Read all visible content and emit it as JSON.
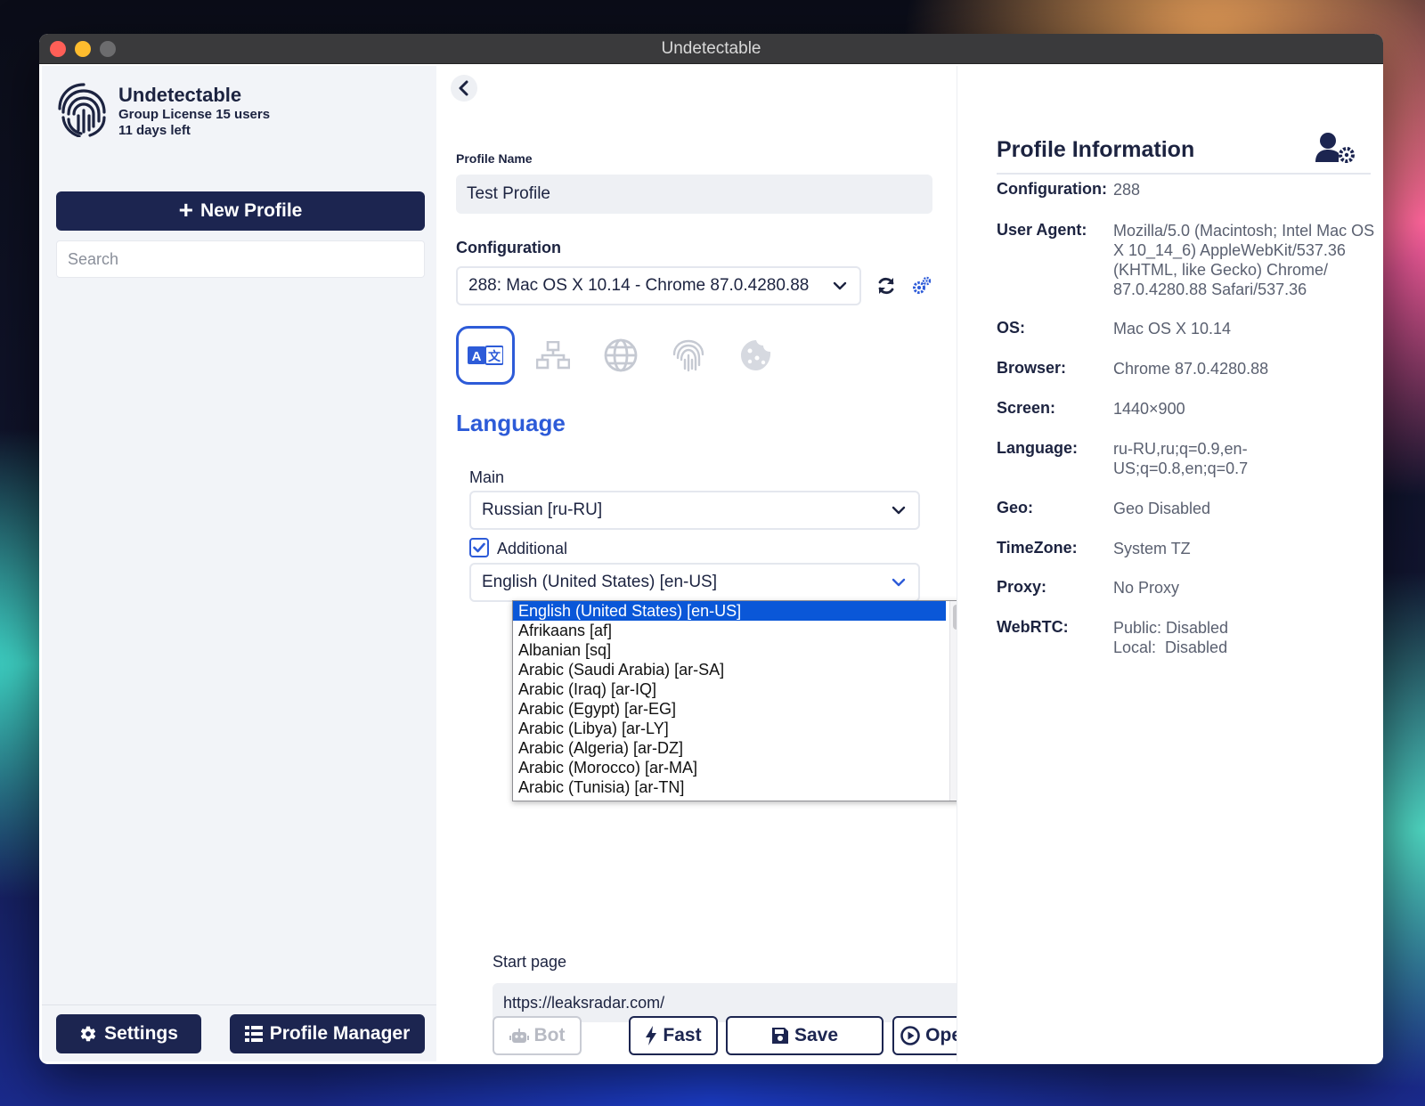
{
  "window": {
    "title": "Undetectable"
  },
  "sidebar": {
    "brand_name": "Undetectable",
    "license": "Group License 15 users",
    "days_left": "11 days left",
    "new_profile_label": "New Profile",
    "search_placeholder": "Search",
    "settings_label": "Settings",
    "profile_manager_label": "Profile Manager"
  },
  "editor": {
    "profile_name_label": "Profile Name",
    "profile_name_value": "Test Profile",
    "configuration_label": "Configuration",
    "configuration_value": "288: Mac OS X 10.14 - Chrome 87.0.4280.88",
    "section_title": "Language",
    "main_label": "Main",
    "main_value": "Russian [ru-RU]",
    "additional_label": "Additional",
    "additional_checked": true,
    "additional_value": "English (United States) [en-US]",
    "language_options": [
      "English (United States) [en-US]",
      "Afrikaans [af]",
      "Albanian [sq]",
      "Arabic (Saudi Arabia) [ar-SA]",
      "Arabic (Iraq) [ar-IQ]",
      "Arabic (Egypt) [ar-EG]",
      "Arabic (Libya) [ar-LY]",
      "Arabic (Algeria) [ar-DZ]",
      "Arabic (Morocco) [ar-MA]",
      "Arabic (Tunisia) [ar-TN]"
    ],
    "start_page_label": "Start page",
    "start_page_value": "https://leaksradar.com/",
    "bot_label": "Bot",
    "fast_label": "Fast",
    "save_label": "Save",
    "open_label": "Open"
  },
  "info": {
    "title": "Profile Information",
    "rows": [
      {
        "key": "Configuration:",
        "value": "288"
      },
      {
        "key": "User Agent:",
        "value": "Mozilla/5.0 (Macintosh; Intel Mac OS X 10_14_6) AppleWebKit/537.36 (KHTML, like Gecko) Chrome/ 87.0.4280.88 Safari/537.36"
      },
      {
        "key": "OS:",
        "value": "Mac OS X 10.14"
      },
      {
        "key": "Browser:",
        "value": "Chrome 87.0.4280.88"
      },
      {
        "key": "Screen:",
        "value": "1440×900"
      },
      {
        "key": "Language:",
        "value": "ru-RU,ru;q=0.9,en-US;q=0.8,en;q=0.7"
      },
      {
        "key": "Geo:",
        "value": "Geo Disabled"
      },
      {
        "key": "TimeZone:",
        "value": "System TZ"
      },
      {
        "key": "Proxy:",
        "value": "No Proxy"
      },
      {
        "key": "WebRTC:",
        "value": "Public: Disabled",
        "value2": "Local:  Disabled"
      }
    ]
  },
  "colors": {
    "accent": "#2d5bd8",
    "navy": "#1c2550",
    "selection": "#0a57d8"
  }
}
